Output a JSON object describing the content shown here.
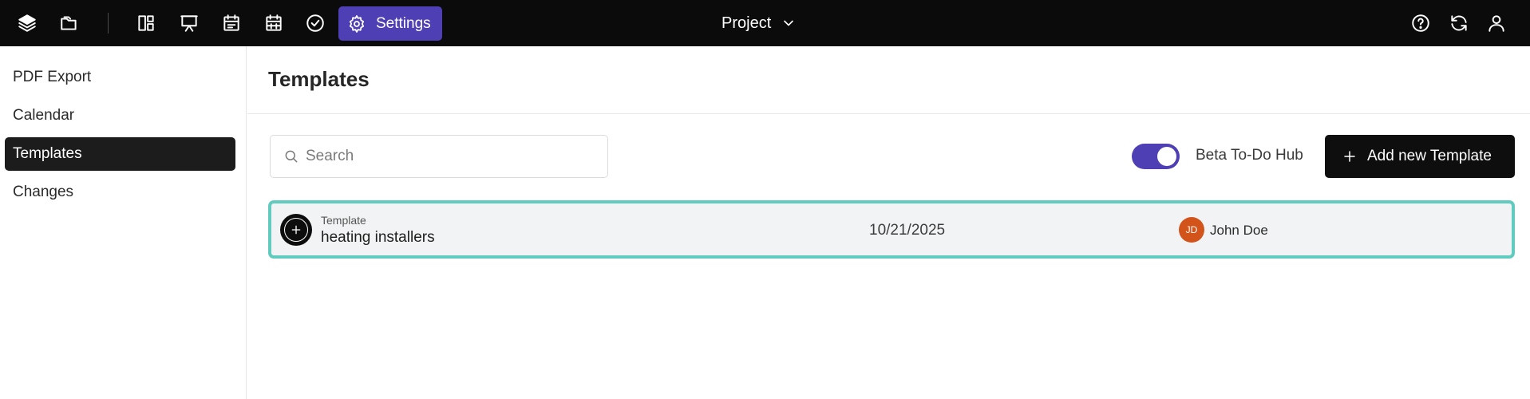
{
  "topbar": {
    "settings_label": "Settings",
    "project_label": "Project",
    "icons": [
      "layers-icon",
      "folder-icon",
      "dashboard-icon",
      "presentation-icon",
      "calendar-icon",
      "calendar-grid-icon",
      "check-circle-icon",
      "gear-icon",
      "chevron-down-icon",
      "help-icon",
      "refresh-icon",
      "user-icon"
    ],
    "accent_color": "#4f3fb4"
  },
  "sidebar": {
    "items": [
      {
        "label": "PDF Export",
        "active": false
      },
      {
        "label": "Calendar",
        "active": false
      },
      {
        "label": "Templates",
        "active": true
      },
      {
        "label": "Changes",
        "active": false
      }
    ]
  },
  "main": {
    "title": "Templates",
    "search": {
      "placeholder": "Search",
      "value": ""
    },
    "toggle": {
      "label": "Beta To-Do Hub",
      "on": true
    },
    "add_button_label": "Add new Template",
    "rows": [
      {
        "type": "Template",
        "name": "heating installers",
        "date": "10/21/2025",
        "user_initials": "JD",
        "user_name": "John Doe"
      }
    ]
  }
}
